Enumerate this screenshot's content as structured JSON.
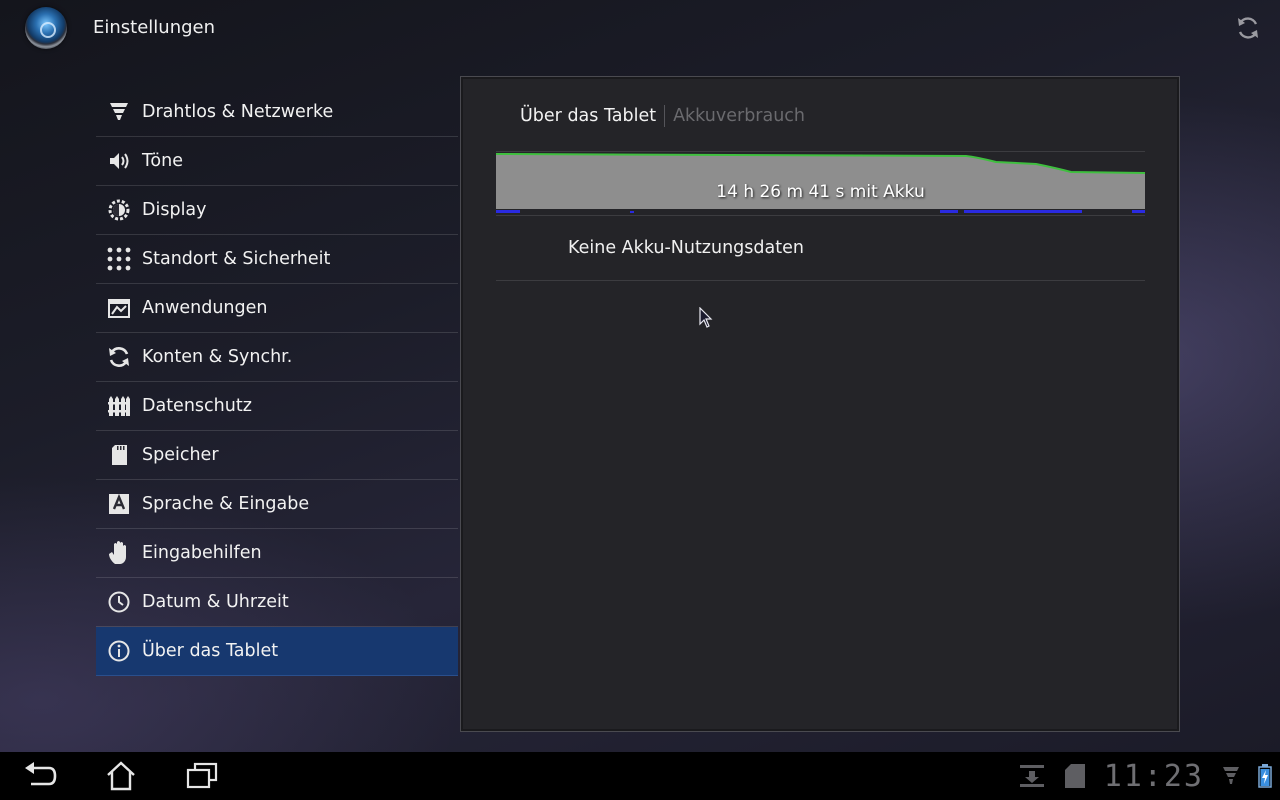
{
  "app": {
    "title": "Einstellungen",
    "icon": "settings-app-icon"
  },
  "sidebar": {
    "items": [
      {
        "label": "Drahtlos & Netzwerke",
        "icon": "wifi-icon",
        "active": false
      },
      {
        "label": "Töne",
        "icon": "speaker-icon",
        "active": false
      },
      {
        "label": "Display",
        "icon": "brightness-icon",
        "active": false
      },
      {
        "label": "Standort & Sicherheit",
        "icon": "pattern-lock-icon",
        "active": false
      },
      {
        "label": "Anwendungen",
        "icon": "apps-icon",
        "active": false
      },
      {
        "label": "Konten & Synchr.",
        "icon": "sync-icon",
        "active": false
      },
      {
        "label": "Datenschutz",
        "icon": "fence-icon",
        "active": false
      },
      {
        "label": "Speicher",
        "icon": "sd-card-icon",
        "active": false
      },
      {
        "label": "Sprache & Eingabe",
        "icon": "keyboard-a-icon",
        "active": false
      },
      {
        "label": "Eingabehilfen",
        "icon": "hand-icon",
        "active": false
      },
      {
        "label": "Datum & Uhrzeit",
        "icon": "clock-icon",
        "active": false
      },
      {
        "label": "Über das Tablet",
        "icon": "info-icon",
        "active": true
      }
    ]
  },
  "content": {
    "breadcrumb": {
      "parent": "Über das Tablet",
      "current": "Akkuverbrauch"
    },
    "battery_chart_label": "14 h 26 m 41 s mit Akku",
    "no_data": "Keine Akku-Nutzungsdaten"
  },
  "system_bar": {
    "clock": "11:23"
  },
  "colors": {
    "accent": "#17386f",
    "battery_line": "#3fbf3f",
    "chart_fill": "#8e8e8e",
    "usage_marks": "#2a2ae0"
  }
}
